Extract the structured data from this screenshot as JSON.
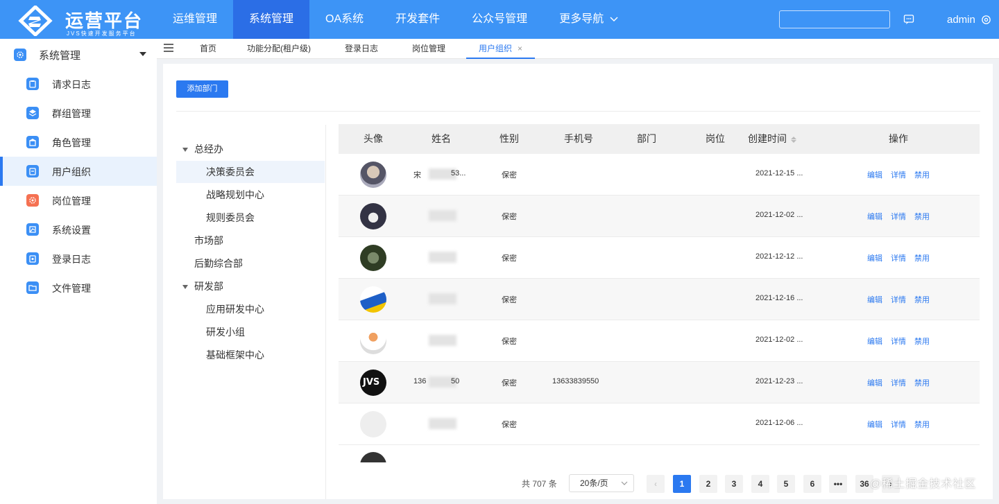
{
  "header": {
    "logo_title": "运营平台",
    "logo_subtitle": "JVS快速开发服务平台",
    "nav": [
      {
        "label": "运维管理",
        "active": false
      },
      {
        "label": "系统管理",
        "active": true
      },
      {
        "label": "OA系统",
        "active": false
      },
      {
        "label": "开发套件",
        "active": false
      },
      {
        "label": "公众号管理",
        "active": false
      },
      {
        "label": "更多导航",
        "active": false
      }
    ],
    "search_placeholder": "",
    "username": "admin",
    "colors": {
      "bar": "#3d94f6",
      "active_nav": "#2b6ee6"
    }
  },
  "sidebar": {
    "group_title": "系统管理",
    "items": [
      {
        "label": "请求日志",
        "icon": "clipboard-icon"
      },
      {
        "label": "群组管理",
        "icon": "group-icon"
      },
      {
        "label": "角色管理",
        "icon": "role-icon"
      },
      {
        "label": "用户组织",
        "icon": "user-org-icon",
        "active": true
      },
      {
        "label": "岗位管理",
        "icon": "position-icon"
      },
      {
        "label": "系统设置",
        "icon": "settings-icon"
      },
      {
        "label": "登录日志",
        "icon": "login-log-icon"
      },
      {
        "label": "文件管理",
        "icon": "folder-icon"
      }
    ]
  },
  "tabs": [
    {
      "label": "首页"
    },
    {
      "label": "功能分配(租户级)"
    },
    {
      "label": "登录日志"
    },
    {
      "label": "岗位管理"
    },
    {
      "label": "用户组织",
      "active": true,
      "close": "×"
    }
  ],
  "toolbar": {
    "add_dept_label": "添加部门"
  },
  "tree": [
    {
      "label": "总经办",
      "level": 0,
      "expanded": true
    },
    {
      "label": "决策委员会",
      "level": 1,
      "selected": true
    },
    {
      "label": "战略规划中心",
      "level": 1
    },
    {
      "label": "规则委员会",
      "level": 1
    },
    {
      "label": "市场部",
      "level": 0
    },
    {
      "label": "后勤综合部",
      "level": 0
    },
    {
      "label": "研发部",
      "level": 0,
      "expanded": true
    },
    {
      "label": "应用研发中心",
      "level": 1
    },
    {
      "label": "研发小组",
      "level": 1
    },
    {
      "label": "基础框架中心",
      "level": 1
    }
  ],
  "table": {
    "columns": [
      "头像",
      "姓名",
      "性别",
      "手机号",
      "部门",
      "岗位",
      "创建时间",
      "操作"
    ],
    "rows": [
      {
        "name_prefix": "宋",
        "name_suffix": "53...",
        "gender": "保密",
        "phone": "",
        "created": "2021-12-15 ..."
      },
      {
        "name_prefix": "",
        "name_suffix": "",
        "gender": "保密",
        "phone": "",
        "created": "2021-12-02 ..."
      },
      {
        "name_prefix": "",
        "name_suffix": "",
        "gender": "保密",
        "phone": "",
        "created": "2021-12-12 ..."
      },
      {
        "name_prefix": "",
        "name_suffix": "",
        "gender": "保密",
        "phone": "",
        "created": "2021-12-16 ..."
      },
      {
        "name_prefix": "",
        "name_suffix": "",
        "gender": "保密",
        "phone": "",
        "created": "2021-12-02 ..."
      },
      {
        "name_prefix": "136",
        "name_suffix": "50",
        "gender": "保密",
        "phone": "13633839550",
        "created": "2021-12-23 ..."
      },
      {
        "name_prefix": "",
        "name_suffix": "",
        "gender": "保密",
        "phone": "",
        "created": "2021-12-06 ..."
      }
    ],
    "actions": {
      "edit": "编辑",
      "detail": "详情",
      "disable": "禁用"
    }
  },
  "pagination": {
    "total_text": "共 707 条",
    "page_size": "20条/页",
    "pages": [
      "1",
      "2",
      "3",
      "4",
      "5",
      "6",
      "•••",
      "36"
    ],
    "current": "1",
    "prev": "‹",
    "next": "›"
  },
  "watermark": "@稀土掘金技术社区"
}
